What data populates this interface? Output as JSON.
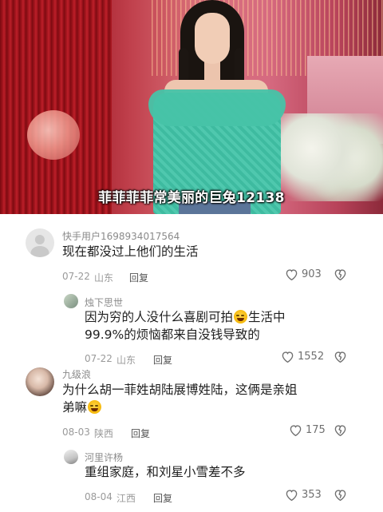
{
  "video": {
    "caption": "菲菲菲菲常美丽的巨兔12138"
  },
  "comments": [
    {
      "username": "快手用户1698934017564",
      "text_lines": [
        "现在都没过上他们的生活"
      ],
      "date": "07-22",
      "location": "山东",
      "reply_label": "回复",
      "likes": "903",
      "avatar": "default-avatar"
    },
    {
      "username": "烛下思世",
      "text_lines": [
        "因为穷的人没什么喜剧可拍",
        "生活中",
        "99.9%的烦恼都来自没钱导致的"
      ],
      "date": "07-22",
      "location": "山东",
      "reply_label": "回复",
      "likes": "1552",
      "avatar": "photo-avatar",
      "emoji": "laughing-emoji"
    },
    {
      "username": "九级浪",
      "text_lines": [
        "为什么胡一菲姓胡陆展博姓陆，这俩是亲姐",
        "弟嘛"
      ],
      "date": "08-03",
      "location": "陕西",
      "reply_label": "回复",
      "likes": "175",
      "avatar": "photo-avatar",
      "emoji": "laughing-emoji"
    },
    {
      "username": "河里许杨",
      "text_lines": [
        "重组家庭，和刘星小雪差不多"
      ],
      "date": "08-04",
      "location": "江西",
      "reply_label": "回复",
      "likes": "353",
      "avatar": "photo-avatar"
    }
  ],
  "colors": {
    "text": "#1e1e1e",
    "meta": "#9a9a9a",
    "caption": "#ffffff"
  }
}
